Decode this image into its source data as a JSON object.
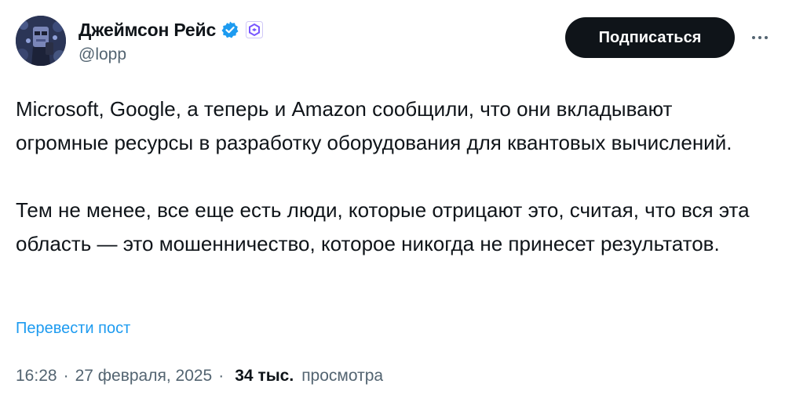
{
  "author": {
    "display_name": "Джеймсон Рейс",
    "handle": "@lopp",
    "verified_icon": "verified-badge-icon",
    "affiliate_icon": "affiliate-badge-icon"
  },
  "actions": {
    "follow_label": "Подписаться",
    "more_icon": "more-options-icon"
  },
  "tweet": {
    "paragraphs": [
      "Microsoft, Google, а теперь и Amazon сообщили, что они вкладывают огромные ресурсы в разработку оборудования для квантовых вычислений.",
      "Тем не менее, все еще есть люди, которые отрицают это, считая, что вся эта область — это мошенничество, которое никогда не принесет результатов."
    ],
    "translate_label": "Перевести пост",
    "time": "16:28",
    "date": "27 февраля, 2025",
    "separator": "·",
    "views_count": "34 тыс.",
    "views_label": "просмотра"
  },
  "colors": {
    "text": "#0f1419",
    "secondary": "#536471",
    "link": "#1d9bf0",
    "verified": "#1d9bf0",
    "affiliate": "#7856ff",
    "button_bg": "#0f1419"
  }
}
